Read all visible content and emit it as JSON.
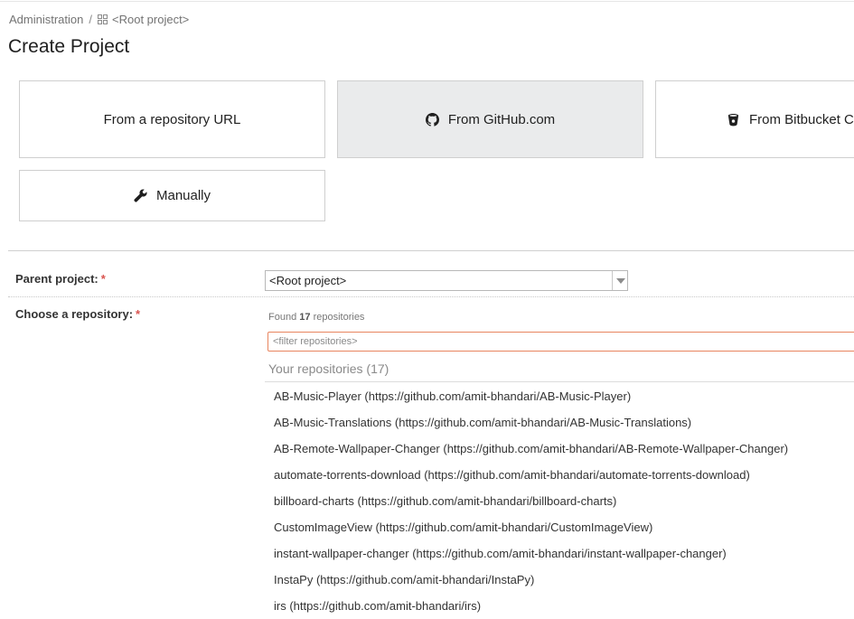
{
  "breadcrumb": {
    "admin": "Administration",
    "separator": "/",
    "current": "<Root project>",
    "current_icon": "grid-icon"
  },
  "page_title": "Create Project",
  "tiles": {
    "url": {
      "label": "From a repository URL"
    },
    "github": {
      "label": "From GitHub.com",
      "icon": "github-icon",
      "selected": true
    },
    "bitbucket": {
      "label": "From Bitbucket C",
      "icon": "bitbucket-icon"
    },
    "manual": {
      "label": "Manually",
      "icon": "wrench-icon"
    }
  },
  "form": {
    "parent_label": "Parent project:",
    "required_mark": "*",
    "parent_value": "<Root project>",
    "repo_label": "Choose a repository:"
  },
  "repositories": {
    "found_prefix": "Found",
    "found_count": "17",
    "found_suffix": "repositories",
    "filter_placeholder": "<filter repositories>",
    "heading": "Your repositories (17)",
    "items": [
      "AB-Music-Player (https://github.com/amit-bhandari/AB-Music-Player)",
      "AB-Music-Translations (https://github.com/amit-bhandari/AB-Music-Translations)",
      "AB-Remote-Wallpaper-Changer (https://github.com/amit-bhandari/AB-Remote-Wallpaper-Changer)",
      "automate-torrents-download (https://github.com/amit-bhandari/automate-torrents-download)",
      "billboard-charts (https://github.com/amit-bhandari/billboard-charts)",
      "CustomImageView (https://github.com/amit-bhandari/CustomImageView)",
      "instant-wallpaper-changer (https://github.com/amit-bhandari/instant-wallpaper-changer)",
      "InstaPy (https://github.com/amit-bhandari/InstaPy)",
      "irs (https://github.com/amit-bhandari/irs)"
    ]
  },
  "colors": {
    "selected_tile_bg": "#eaebec",
    "required": "#d9534f",
    "focus_border": "#e8855f"
  }
}
